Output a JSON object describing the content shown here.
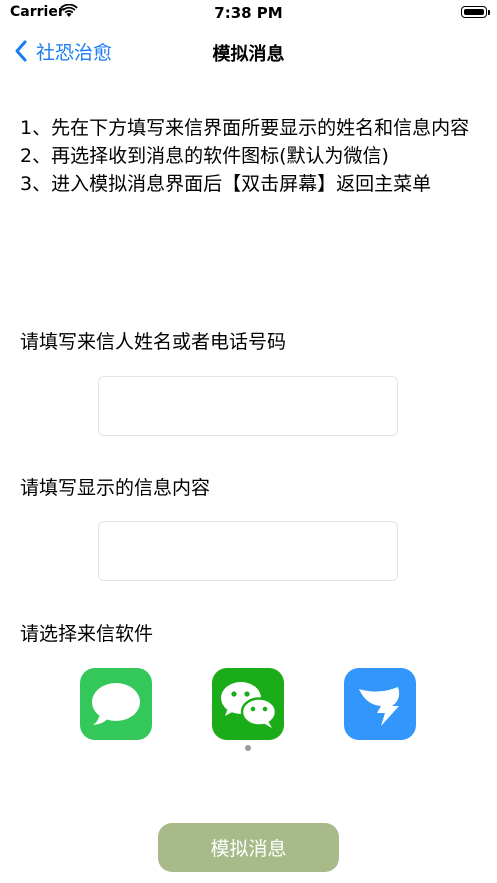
{
  "status_bar": {
    "carrier": "Carrier",
    "time": "7:38 PM",
    "icons": [
      "wifi-icon",
      "battery-icon"
    ]
  },
  "nav": {
    "back_label": "社恐治愈",
    "back_icon": "chevron-left-icon",
    "title": "模拟消息",
    "accent_color": "#1a7cf5"
  },
  "instructions": [
    "1、先在下方填写来信界面所要显示的姓名和信息内容",
    "2、再选择收到消息的软件图标(默认为微信)",
    "3、进入模拟消息界面后【双击屏幕】返回主菜单"
  ],
  "form": {
    "name_label": "请填写来信人姓名或者电话号码",
    "name_value": "",
    "content_label": "请填写显示的信息内容",
    "content_value": "",
    "app_label": "请选择来信软件"
  },
  "apps": [
    {
      "name": "messages",
      "icon": "messages-icon",
      "color": "#34c759"
    },
    {
      "name": "wechat",
      "icon": "wechat-icon",
      "color": "#1aad19",
      "selected": true
    },
    {
      "name": "dingtalk",
      "icon": "dingtalk-icon",
      "color": "#3296fa"
    }
  ],
  "submit_label": "模拟消息",
  "submit_color": "#a8ba8a"
}
